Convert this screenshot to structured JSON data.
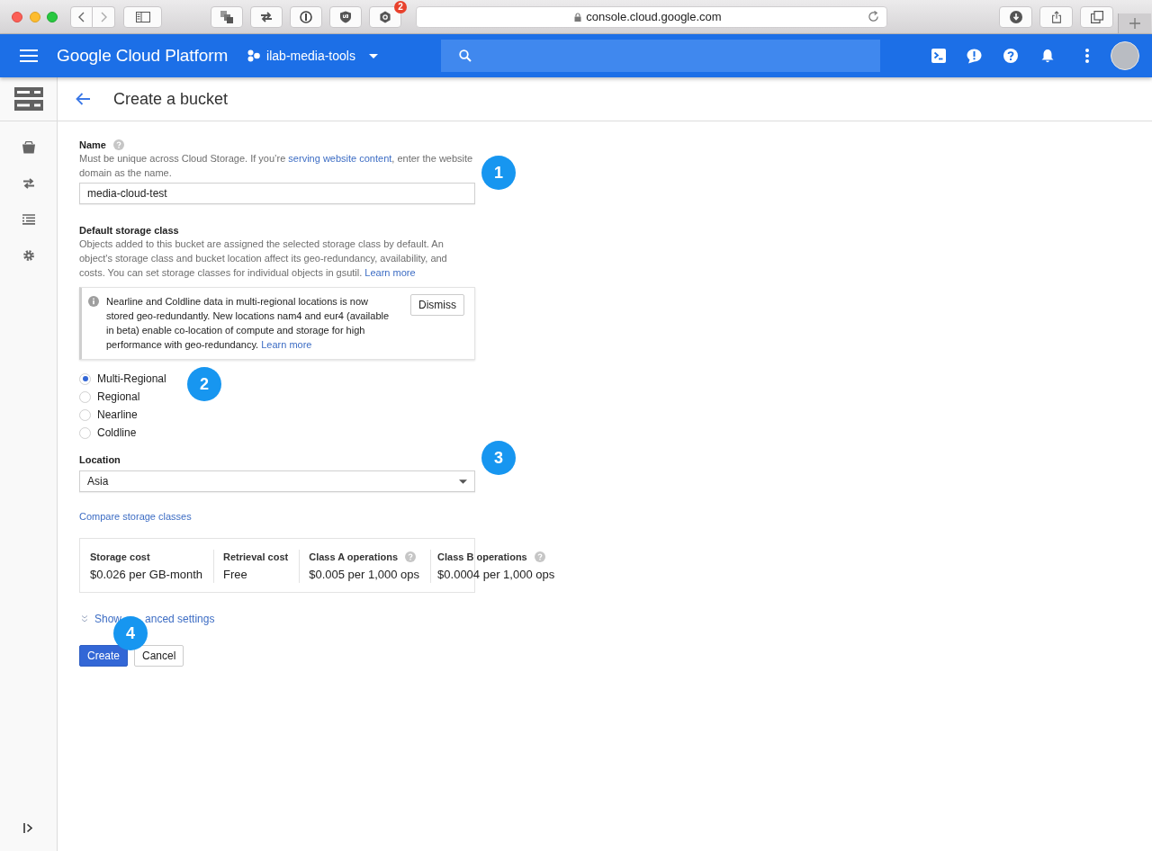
{
  "browser": {
    "url": "console.cloud.google.com",
    "extension_count": "2"
  },
  "header": {
    "product": "Google Cloud Platform",
    "project": "ilab-media-tools"
  },
  "page": {
    "title": "Create a bucket"
  },
  "name_section": {
    "label": "Name",
    "help": true,
    "description": [
      {
        "kind": "text",
        "text": "Must be unique across Cloud Storage. If you’re "
      },
      {
        "kind": "link",
        "text": "serving website content"
      },
      {
        "kind": "text",
        "text": ", enter the website domain as the name."
      }
    ],
    "value": "media-cloud-test",
    "step": "1"
  },
  "storage_class": {
    "label": "Default storage class",
    "description": [
      {
        "kind": "text",
        "text": "Objects added to this bucket are assigned the selected storage class by default. An object's storage class and bucket location affect its geo-redundancy, availability, and costs. You can set storage classes for individual objects in gsutil. "
      },
      {
        "kind": "link",
        "text": "Learn more"
      }
    ],
    "notice": {
      "text": [
        {
          "kind": "text",
          "text": "Nearline and Coldline data in multi-regional locations is now stored geo-redundantly. New locations nam4 and eur4 (available in beta) enable co-location of compute and storage for high performance with geo-redundancy. "
        },
        {
          "kind": "link",
          "text": "Learn more"
        }
      ],
      "dismiss": "Dismiss"
    },
    "options": [
      {
        "label": "Multi-Regional",
        "selected": true
      },
      {
        "label": "Regional",
        "selected": false
      },
      {
        "label": "Nearline",
        "selected": false
      },
      {
        "label": "Coldline",
        "selected": false
      }
    ],
    "step": "2"
  },
  "location": {
    "label": "Location",
    "value": "Asia",
    "step": "3"
  },
  "compare_link": "Compare storage classes",
  "pricing": [
    {
      "label": "Storage cost",
      "value": "$0.026 per GB-month",
      "help": false
    },
    {
      "label": "Retrieval cost",
      "value": "Free",
      "help": false
    },
    {
      "label": "Class A operations",
      "value": "$0.005 per 1,000 ops",
      "help": true
    },
    {
      "label": "Class B operations",
      "value": "$0.0004 per 1,000 ops",
      "help": true
    }
  ],
  "advanced_link": {
    "visible_start": "Show",
    "visible_end": "anced settings"
  },
  "actions": {
    "buttons": [
      {
        "label": "Create",
        "kind": "primary"
      },
      {
        "label": "Cancel",
        "kind": "secondary"
      }
    ],
    "step": "4"
  }
}
